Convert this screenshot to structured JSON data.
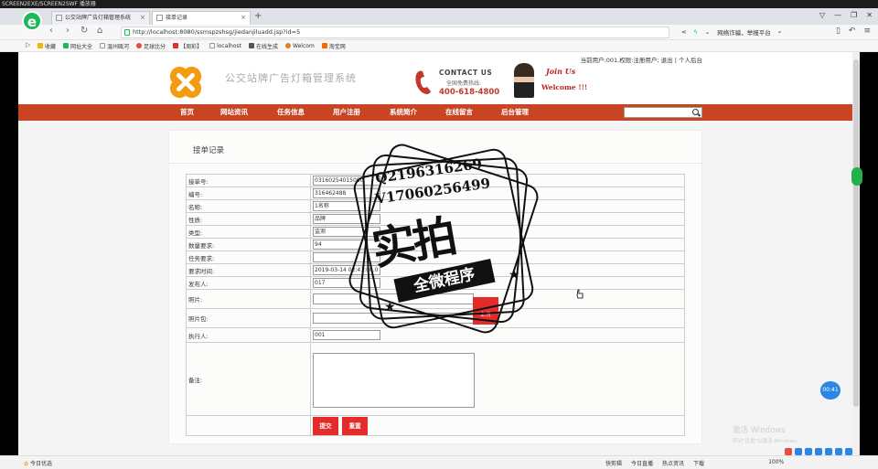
{
  "window": {
    "title": "SCREEN2EXE/SCREEN2SWF 播放器"
  },
  "browser": {
    "tabs": [
      {
        "label": "公交站牌广告灯箱管理系统",
        "active": false
      },
      {
        "label": "接单记录",
        "active": true
      }
    ],
    "url": "http://localhost:8080/ssmspzshsg/jiedanjiluadd.jsp?id=5",
    "right_label": "网络诈骗，举报平台",
    "bookmarks": [
      "收藏",
      "网址大全",
      "温州瓯河",
      "足球比分",
      "【周彩】",
      "localhost",
      "在线生成",
      "Welcom",
      "淘宝网"
    ]
  },
  "site": {
    "top_links": "当前用户:001,权限:注册用户; 退出 | 个人后台",
    "title": "公交站牌广告灯箱管理系统",
    "contact_title": "CONTACT US",
    "contact_sub": "全国免费热线:",
    "contact_number": "400-618-4800",
    "join_us": "Join Us",
    "welcome": "Welcome !!!",
    "nav": [
      "首页",
      "网站资讯",
      "任务信息",
      "用户注册",
      "系统简介",
      "在线留言",
      "后台管理"
    ],
    "search_placeholder": ""
  },
  "form": {
    "title": "接单记录",
    "fields": {
      "order_no": {
        "label": "接单号:",
        "value": "03160254015080"
      },
      "code": {
        "label": "编号:",
        "value": "316462488"
      },
      "name": {
        "label": "名称:",
        "value": "1名称"
      },
      "nature": {
        "label": "性质:",
        "value": "品牌"
      },
      "type": {
        "label": "类型:",
        "value": "监测"
      },
      "quantity": {
        "label": "数量要求:",
        "value": "94"
      },
      "task_req": {
        "label": "任务要求:",
        "value": ""
      },
      "req_time": {
        "label": "要求时间:",
        "value": "2019-03-14 02:41:00.0"
      },
      "publisher": {
        "label": "发布人:",
        "value": "017"
      },
      "photo": {
        "label": "照片:",
        "value": ""
      },
      "photo_pkg": {
        "label": "照片包:",
        "value": ""
      },
      "executor": {
        "label": "执行人:",
        "value": "001"
      },
      "remarks": {
        "label": "备注:",
        "value": ""
      }
    },
    "upload_label": "上传",
    "submit_label": "提交",
    "reset_label": "重置"
  },
  "watermark": {
    "qq": "Q2196316269",
    "v": "V17060256499",
    "big": "实拍",
    "banner": "全微程序"
  },
  "floating_badge": "00:41",
  "activation": {
    "line1": "激活 Windows",
    "line2": "转到\"设置\"以激活 Windows。"
  },
  "statusbar": {
    "left": "今日优选",
    "right": [
      "快剪辑",
      "今日直播",
      "热点资讯",
      "下载",
      "100%"
    ]
  },
  "colors": {
    "nav_red": "#c84422",
    "button_red": "#e52a2a",
    "accent_green": "#1eb858",
    "badge_blue": "#2b86e6"
  }
}
